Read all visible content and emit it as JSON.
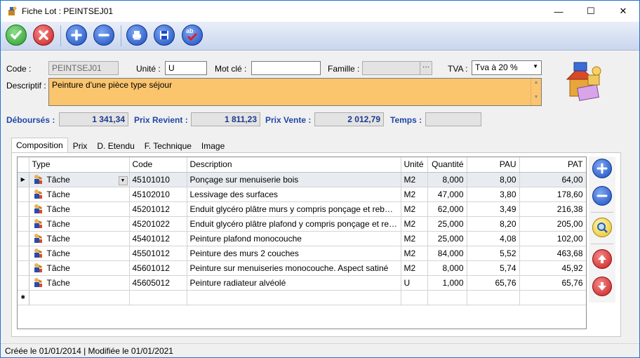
{
  "window": {
    "title": "Fiche Lot : PEINTSEJ01",
    "controls": {
      "minimize": "—",
      "maximize": "☐",
      "close": "✕"
    }
  },
  "toolbar": {
    "validate_icon": "check-icon",
    "cancel_icon": "x-icon",
    "add_icon": "plus-icon",
    "remove_icon": "minus-icon",
    "print_icon": "printer-icon",
    "save_icon": "floppy-icon",
    "spellcheck_icon": "spellcheck-icon",
    "spellcheck_text": "ab"
  },
  "form": {
    "code_label": "Code :",
    "code_value": "PEINTSEJ01",
    "unite_label": "Unité :",
    "unite_value": "U",
    "motcle_label": "Mot clé :",
    "motcle_value": "",
    "famille_label": "Famille :",
    "famille_value": "",
    "famille_button": "···",
    "tva_label": "TVA :",
    "tva_value": "Tva à 20 %",
    "descriptif_label": "Descriptif :",
    "descriptif_value": "Peinture d'une pièce type séjour"
  },
  "totals": {
    "debourses_label": "Déboursés :",
    "debourses_value": "1 341,34",
    "prix_revient_label": "Prix Revient :",
    "prix_revient_value": "1 811,23",
    "prix_vente_label": "Prix Vente :",
    "prix_vente_value": "2 012,79",
    "temps_label": "Temps :",
    "temps_value": ""
  },
  "tabs": [
    {
      "label": "Composition",
      "active": true
    },
    {
      "label": "Prix"
    },
    {
      "label": "D. Etendu"
    },
    {
      "label": "F. Technique"
    },
    {
      "label": "Image"
    }
  ],
  "grid": {
    "columns": [
      "Type",
      "Code",
      "Description",
      "Unité",
      "Quantité",
      "PAU",
      "PAT"
    ],
    "current_row_marker": "▶",
    "new_row_marker": "✱",
    "rows": [
      {
        "type": "Tâche",
        "code": "45101010",
        "description": "Ponçage sur menuiserie bois",
        "unite": "M2",
        "quantite": "8,000",
        "pau": "8,00",
        "pat": "64,00"
      },
      {
        "type": "Tâche",
        "code": "45102010",
        "description": "Lessivage des surfaces",
        "unite": "M2",
        "quantite": "47,000",
        "pau": "3,80",
        "pat": "178,60"
      },
      {
        "type": "Tâche",
        "code": "45201012",
        "description": "Enduit glycéro plâtre murs y compris ponçage et rebouchage",
        "unite": "M2",
        "quantite": "62,000",
        "pau": "3,49",
        "pat": "216,38"
      },
      {
        "type": "Tâche",
        "code": "45201022",
        "description": "Enduit glycéro plâtre plafond y compris ponçage et rebouch...",
        "unite": "M2",
        "quantite": "25,000",
        "pau": "8,20",
        "pat": "205,00"
      },
      {
        "type": "Tâche",
        "code": "45401012",
        "description": "Peinture plafond monocouche",
        "unite": "M2",
        "quantite": "25,000",
        "pau": "4,08",
        "pat": "102,00"
      },
      {
        "type": "Tâche",
        "code": "45501012",
        "description": "Peinture des murs 2 couches",
        "unite": "M2",
        "quantite": "84,000",
        "pau": "5,52",
        "pat": "463,68"
      },
      {
        "type": "Tâche",
        "code": "45601012",
        "description": "Peinture sur menuiseries monocouche. Aspect satiné",
        "unite": "M2",
        "quantite": "8,000",
        "pau": "5,74",
        "pat": "45,92"
      },
      {
        "type": "Tâche",
        "code": "45605012",
        "description": "Peinture radiateur alvéolé",
        "unite": "U",
        "quantite": "1,000",
        "pau": "65,76",
        "pat": "65,76"
      }
    ]
  },
  "side_buttons": [
    "plus-icon",
    "minus-icon",
    "magnifier-icon",
    "arrow-up-icon",
    "arrow-down-icon"
  ],
  "status": {
    "text": "Créée le 01/01/2014 | Modifiée le 01/01/2021"
  },
  "colors": {
    "accent_blue": "#2246a8",
    "descriptif_bg": "#fbc56e",
    "validate_green": "#33a333",
    "cancel_red": "#d62a2a",
    "action_blue": "#1f55c8"
  }
}
